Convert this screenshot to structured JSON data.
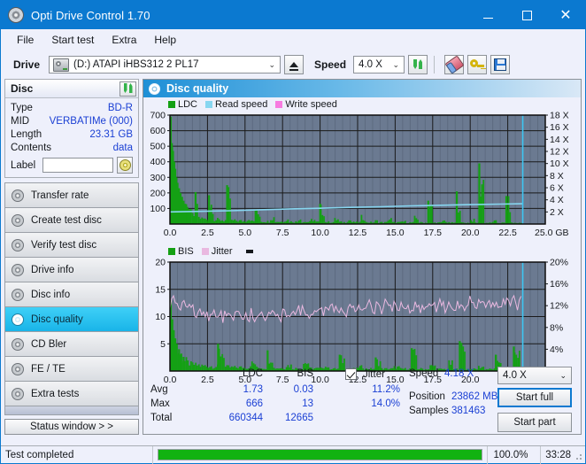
{
  "window": {
    "title": "Opti Drive Control 1.70",
    "icon": "disc-icon",
    "minimize": "–",
    "maximize": "□",
    "close": "✕"
  },
  "menu": [
    "File",
    "Start test",
    "Extra",
    "Help"
  ],
  "toolbar": {
    "drive_label": "Drive",
    "drive_value": "(D:)  ATAPI iHBS312  2 PL17",
    "eject_title": "Eject",
    "speed_label": "Speed",
    "speed_value": "4.0 X",
    "refresh_icon": "refresh-icon",
    "erase_icon": "eraser-icon",
    "key_icon": "key-icon",
    "save_icon": "floppy-save-icon"
  },
  "disc_panel": {
    "title": "Disc",
    "refresh_icon": "refresh-icon",
    "rows": [
      {
        "key": "Type",
        "value": "BD-R"
      },
      {
        "key": "MID",
        "value": "VERBATIMe (000)"
      },
      {
        "key": "Length",
        "value": "23.31 GB"
      },
      {
        "key": "Contents",
        "value": "data"
      }
    ],
    "label_key": "Label",
    "label_value": "",
    "label_placeholder": "",
    "disc_icon": "cd-disc-icon"
  },
  "sidebar": {
    "items": [
      {
        "label": "Transfer rate",
        "selected": false
      },
      {
        "label": "Create test disc",
        "selected": false
      },
      {
        "label": "Verify test disc",
        "selected": false
      },
      {
        "label": "Drive info",
        "selected": false
      },
      {
        "label": "Disc info",
        "selected": false
      },
      {
        "label": "Disc quality",
        "selected": true
      },
      {
        "label": "CD Bler",
        "selected": false
      },
      {
        "label": "FE / TE",
        "selected": false
      },
      {
        "label": "Extra tests",
        "selected": false
      }
    ],
    "status_window": "Status window > >"
  },
  "content": {
    "title": "Disc quality",
    "icon": "disc-quality-icon"
  },
  "chart_data": [
    {
      "type": "area",
      "title": "LDC / Read speed",
      "xlabel": "GB",
      "ylabel": "",
      "xlim": [
        0.0,
        25.0
      ],
      "ylim": [
        0,
        700
      ],
      "y2lim": [
        0,
        18
      ],
      "grid": true,
      "legend_position": "top-left",
      "legend": [
        {
          "name": "LDC",
          "color": "#14a014"
        },
        {
          "name": "Read speed",
          "color": "#87d6f0"
        },
        {
          "name": "Write speed",
          "color": "#f77ce0"
        }
      ],
      "xticks": [
        "0.0",
        "2.5",
        "5.0",
        "7.5",
        "10.0",
        "12.5",
        "15.0",
        "17.5",
        "20.0",
        "22.5",
        "25.0 GB"
      ],
      "yticks": [
        "700",
        "600",
        "500",
        "400",
        "300",
        "200",
        "100"
      ],
      "y2ticks": [
        "18 X",
        "16 X",
        "14 X",
        "12 X",
        "10 X",
        "8 X",
        "6 X",
        "4 X",
        "2 X"
      ],
      "series": [
        {
          "name": "LDC",
          "color": "#14a014",
          "x": [
            0.05,
            0.12,
            0.2,
            0.28,
            0.35,
            0.42,
            0.5,
            0.6,
            0.7,
            0.8,
            0.9,
            1.0,
            1.15,
            1.3,
            1.5,
            1.7,
            1.9,
            2.1,
            2.3,
            2.6,
            2.9,
            3.2,
            3.5,
            3.8,
            4.1,
            4.45,
            4.8,
            5.1,
            5.4,
            5.7,
            6.0,
            6.35,
            6.7,
            7.0,
            7.3,
            7.6,
            7.9,
            8.2,
            8.5,
            8.8,
            9.1,
            9.4,
            9.7,
            10.0,
            10.3,
            10.6,
            10.9,
            11.2,
            11.5,
            11.8,
            12.1,
            12.4,
            12.7,
            13.0,
            13.3,
            13.6,
            13.9,
            14.2,
            14.5,
            14.8,
            15.1,
            15.4,
            15.7,
            16.0,
            16.3,
            16.6,
            16.9,
            17.2,
            17.5,
            17.8,
            18.1,
            18.45,
            18.8,
            19.1,
            19.4,
            19.7,
            20.0,
            20.3,
            20.6,
            20.9,
            21.2,
            21.5,
            21.8,
            22.1,
            22.4,
            22.7,
            23.0,
            23.3,
            23.5
          ],
          "y": [
            690,
            520,
            470,
            400,
            355,
            300,
            265,
            230,
            200,
            175,
            150,
            130,
            110,
            95,
            80,
            205,
            60,
            50,
            45,
            185,
            40,
            38,
            35,
            250,
            32,
            30,
            28,
            48,
            26,
            95,
            25,
            24,
            60,
            23,
            22,
            40,
            22,
            21,
            55,
            20,
            20,
            38,
            19,
            130,
            19,
            18,
            42,
            18,
            17,
            35,
            17,
            17,
            60,
            16,
            16,
            28,
            16,
            15,
            45,
            15,
            15,
            22,
            14,
            14,
            55,
            14,
            13,
            150,
            13,
            13,
            30,
            13,
            12,
            210,
            12,
            12,
            35,
            12,
            390,
            11,
            11,
            25,
            11,
            11,
            180,
            11,
            10,
            10,
            10
          ]
        },
        {
          "name": "Read speed",
          "color": "#87d6f0",
          "x": [
            0.0,
            2.0,
            4.0,
            6.0,
            8.0,
            10.0,
            12.0,
            14.0,
            16.0,
            18.0,
            20.0,
            22.0,
            23.5
          ],
          "y": [
            2.0,
            2.1,
            2.2,
            2.35,
            2.5,
            2.6,
            2.75,
            2.85,
            3.0,
            3.1,
            3.2,
            3.3,
            3.35
          ]
        }
      ],
      "end_marker_x": 23.5,
      "end_marker_color": "#3ec6f2"
    },
    {
      "type": "area",
      "title": "BIS / Jitter",
      "xlabel": "GB",
      "ylabel": "",
      "xlim": [
        0.0,
        25.0
      ],
      "ylim": [
        0,
        20
      ],
      "y2lim": [
        0,
        20
      ],
      "grid": true,
      "legend_position": "top-left",
      "legend": [
        {
          "name": "BIS",
          "color": "#14a014"
        },
        {
          "name": "Jitter",
          "color": "#e9b8e0"
        }
      ],
      "xticks": [
        "0.0",
        "2.5",
        "5.0",
        "7.5",
        "10.0",
        "12.5",
        "15.0",
        "17.5",
        "20.0",
        "22.5",
        "25.0 GB"
      ],
      "yticks": [
        "20",
        "15",
        "10",
        "5"
      ],
      "y2ticks": [
        "20%",
        "16%",
        "12%",
        "8%",
        "4%"
      ],
      "series": [
        {
          "name": "BIS",
          "color": "#14a014",
          "x": [
            0.05,
            0.15,
            0.25,
            0.35,
            0.45,
            0.6,
            0.75,
            0.9,
            1.1,
            1.4,
            1.7,
            2.0,
            2.4,
            2.8,
            3.2,
            3.6,
            4.0,
            4.45,
            4.9,
            5.3,
            5.7,
            6.1,
            6.5,
            6.9,
            7.3,
            7.7,
            8.1,
            8.5,
            8.9,
            9.3,
            9.7,
            10.1,
            10.5,
            10.9,
            11.3,
            11.7,
            12.1,
            12.5,
            12.9,
            13.3,
            13.7,
            14.1,
            14.5,
            14.9,
            15.3,
            15.7,
            16.1,
            16.5,
            16.9,
            17.3,
            17.7,
            18.1,
            18.5,
            18.9,
            19.3,
            19.7,
            20.1,
            20.5,
            20.9,
            21.3,
            21.7,
            22.1,
            22.5,
            22.9,
            23.3,
            23.5
          ],
          "y": [
            13,
            9.5,
            7.5,
            6.0,
            5.0,
            4.0,
            3.2,
            2.6,
            2.2,
            1.8,
            1.6,
            1.4,
            1.3,
            1.2,
            5.0,
            1.1,
            1.0,
            1.0,
            0.9,
            2.0,
            0.9,
            0.8,
            3.8,
            0.8,
            0.8,
            1.5,
            0.7,
            0.7,
            2.2,
            0.7,
            0.7,
            1.2,
            0.7,
            0.6,
            3.0,
            0.6,
            0.6,
            1.1,
            0.6,
            0.6,
            2.5,
            0.6,
            0.6,
            1.0,
            0.6,
            0.6,
            4.2,
            0.6,
            0.5,
            1.3,
            0.5,
            0.5,
            2.0,
            0.5,
            5.5,
            0.5,
            0.5,
            1.1,
            0.5,
            0.5,
            3.0,
            0.5,
            0.5,
            4.5,
            0.5,
            0.5
          ]
        },
        {
          "name": "Jitter",
          "color": "#e9b8e0",
          "x": [
            0.2,
            0.5,
            0.8,
            1.1,
            1.4,
            1.7,
            2.0,
            2.3,
            2.6,
            2.9,
            3.2,
            3.5,
            3.8,
            4.1,
            4.4,
            4.7,
            5.0,
            5.3,
            5.6,
            5.9,
            6.2,
            6.5,
            6.8,
            7.1,
            7.4,
            7.7,
            8.0,
            8.3,
            8.6,
            8.9,
            9.2,
            9.5,
            9.8,
            10.1,
            10.4,
            10.7,
            11.0,
            11.3,
            11.6,
            11.9,
            12.2,
            12.5,
            12.8,
            13.1,
            13.4,
            13.7,
            14.0,
            14.3,
            14.6,
            14.9,
            15.2,
            15.5,
            15.8,
            16.1,
            16.4,
            16.7,
            17.0,
            17.3,
            17.6,
            17.9,
            18.2,
            18.5,
            18.8,
            19.1,
            19.4,
            19.7,
            20.0,
            20.3,
            20.6,
            20.9,
            21.2,
            21.5,
            21.8,
            22.1,
            22.4,
            22.7,
            23.0,
            23.3,
            23.5
          ],
          "y": [
            13.0,
            11.8,
            12.2,
            10.9,
            11.5,
            10.3,
            11.0,
            10.2,
            10.6,
            10.0,
            10.5,
            10.1,
            10.7,
            10.2,
            10.4,
            10.0,
            10.3,
            10.5,
            10.2,
            10.6,
            10.3,
            10.8,
            10.4,
            10.9,
            10.5,
            11.0,
            10.6,
            11.1,
            10.7,
            11.2,
            10.8,
            11.3,
            10.9,
            11.4,
            11.0,
            11.6,
            11.1,
            11.5,
            11.2,
            11.7,
            11.3,
            11.8,
            11.4,
            12.0,
            11.5,
            12.1,
            11.6,
            12.2,
            11.7,
            12.1,
            11.6,
            12.0,
            11.5,
            11.9,
            11.4,
            11.8,
            11.5,
            12.0,
            11.6,
            12.2,
            11.7,
            12.4,
            11.8,
            12.3,
            11.9,
            12.5,
            12.0,
            12.4,
            12.1,
            12.6,
            12.2,
            12.5,
            12.3,
            12.7,
            12.2,
            12.6,
            12.1,
            12.4,
            11.5
          ]
        }
      ],
      "end_marker_x": 23.5,
      "end_marker_color": "#3ec6f2"
    }
  ],
  "stats": {
    "col_ldc": "LDC",
    "col_bis": "BIS",
    "jitter_label": "Jitter",
    "jitter_checked": true,
    "rows": [
      {
        "label": "Avg",
        "ldc": "1.73",
        "bis": "0.03",
        "jitter": "11.2%"
      },
      {
        "label": "Max",
        "ldc": "666",
        "bis": "13",
        "jitter": "14.0%"
      },
      {
        "label": "Total",
        "ldc": "660344",
        "bis": "12665",
        "jitter": ""
      }
    ],
    "speed_label": "Speed",
    "speed_value": "4.18 X",
    "position_label": "Position",
    "position_value": "23862 MB",
    "samples_label": "Samples",
    "samples_value": "381463",
    "speed_select": "4.0 X",
    "start_full": "Start full",
    "start_part": "Start part"
  },
  "statusbar": {
    "message": "Test completed",
    "percent_text": "100.0%",
    "percent_value": 100,
    "elapsed": "33:28"
  }
}
